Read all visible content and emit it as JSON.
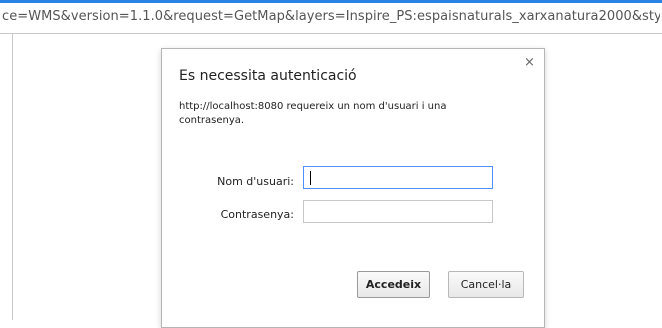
{
  "browser": {
    "url_fragment": "ce=WMS&version=1.1.0&request=GetMap&layers=Inspire_PS:espaisnaturals_xarxanatura2000&sty"
  },
  "auth_dialog": {
    "title": "Es necessita autenticació",
    "message": "http://localhost:8080 requereix un nom d'usuari i una contrasenya.",
    "close_glyph": "×",
    "username_label": "Nom d'usuari:",
    "username_value": "",
    "password_label": "Contrasenya:",
    "password_value": "",
    "login_button": "Accedeix",
    "cancel_button": "Cancel·la"
  },
  "colors": {
    "accent": "#2a82e4",
    "focus_border": "#4d90fe"
  }
}
